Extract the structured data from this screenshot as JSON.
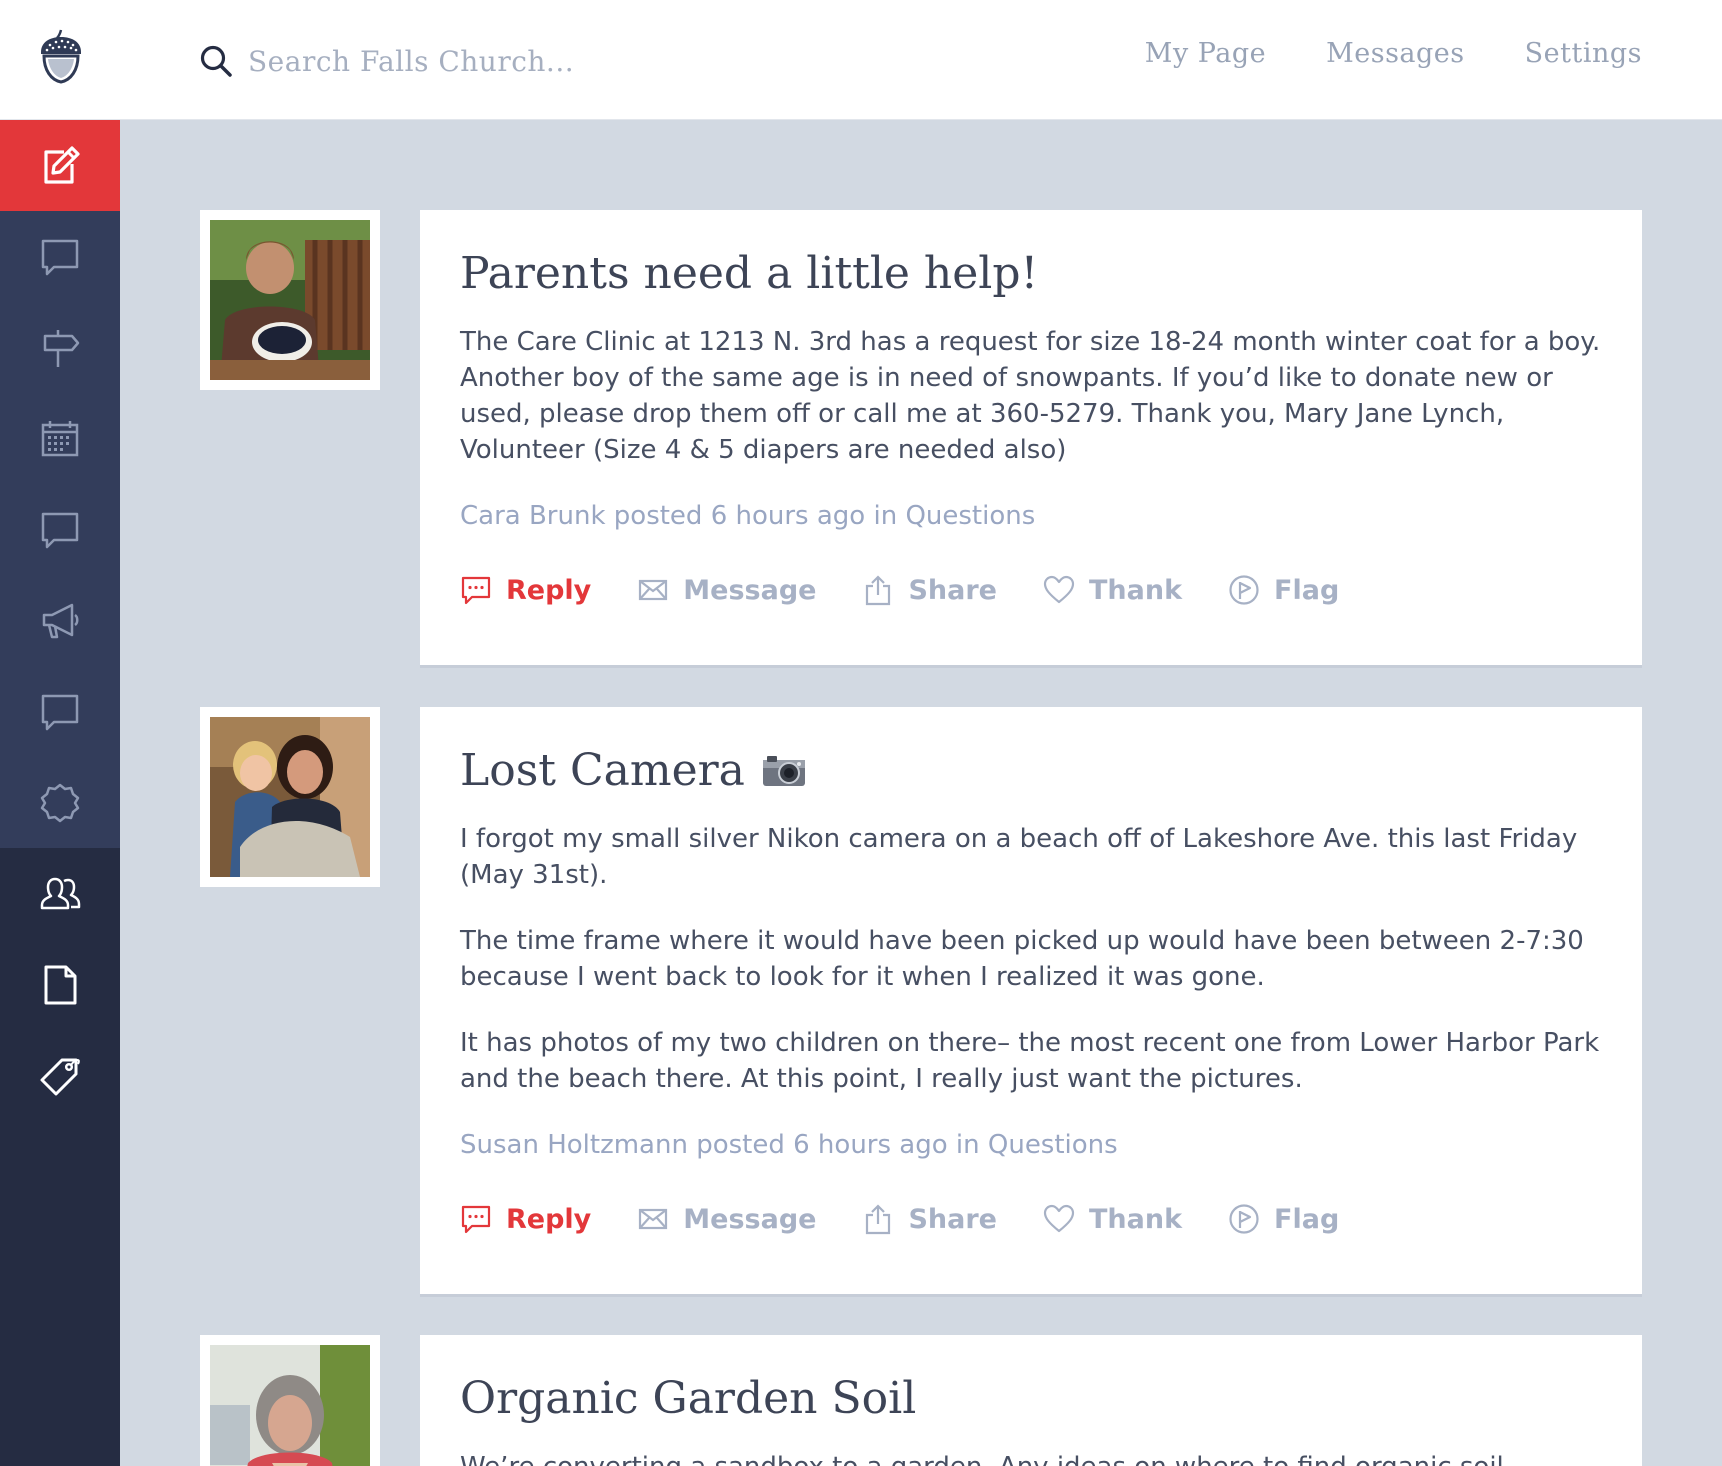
{
  "colors": {
    "accent": "#e3373a",
    "sidebar": "#252c42",
    "background": "#d2d9e2",
    "muted": "#99a6c2"
  },
  "header": {
    "logo": "acorn-logo",
    "search_placeholder": "Search Falls Church...",
    "nav": [
      "My Page",
      "Messages",
      "Settings"
    ]
  },
  "sidebar": {
    "items": [
      {
        "icon": "compose-icon",
        "active": true
      },
      {
        "icon": "chat-bubble-icon"
      },
      {
        "icon": "signpost-icon"
      },
      {
        "icon": "calendar-icon"
      },
      {
        "icon": "chat-bubble-icon"
      },
      {
        "icon": "megaphone-icon"
      },
      {
        "icon": "chat-bubble-icon"
      },
      {
        "icon": "badge-icon"
      },
      {
        "icon": "people-icon"
      },
      {
        "icon": "document-icon"
      },
      {
        "icon": "tag-icon"
      }
    ]
  },
  "actions": {
    "reply": "Reply",
    "message": "Message",
    "share": "Share",
    "thank": "Thank",
    "flag": "Flag"
  },
  "posts": [
    {
      "title": "Parents need a little help!",
      "paragraphs": [
        "The Care Clinic at 1213 N. 3rd has a request for size 18-24 month winter coat for a boy. Another boy of the same age is in need of snowpants. If you’d like to donate new or used, please drop them off or call me at 360-5279. Thank you, Mary Jane Lynch, Volunteer (Size 4 & 5 diapers are needed also)"
      ],
      "meta": "Cara Brunk posted 6 hours ago in Questions"
    },
    {
      "title": "Lost Camera",
      "title_icon": "camera-icon",
      "paragraphs": [
        "I forgot my small silver Nikon camera on a beach off of Lakeshore Ave. this last Friday (May 31st).",
        "The time frame where it would have been picked up would have been between 2-7:30 because I went back to look for it when I realized it was gone.",
        "It has photos of my two children on there– the most recent one from Lower Harbor Park and the beach there. At this point, I really just want the pictures."
      ],
      "meta": "Susan Holtzmann posted 6 hours ago in Questions"
    },
    {
      "title": "Organic Garden Soil",
      "paragraphs": [
        "We’re converting a sandbox to a garden. Any ideas on where to find organic soil"
      ]
    }
  ]
}
